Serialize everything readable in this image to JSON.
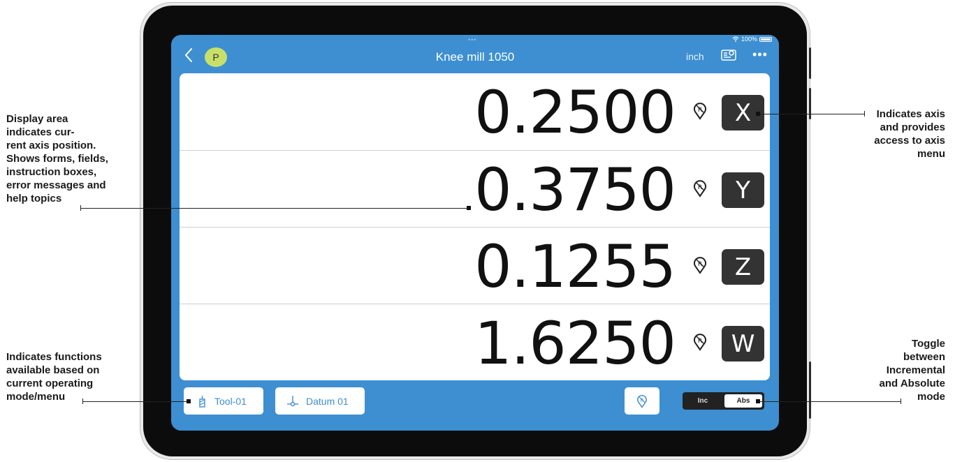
{
  "annotations": {
    "display_area": [
      "Display area",
      "indicates cur-",
      "rent axis position.",
      "Shows forms, fields,",
      "instruction boxes,",
      "error messages and",
      "help topics"
    ],
    "functions": [
      "Indicates functions",
      "available based on",
      "current operating",
      "mode/menu"
    ],
    "axis": [
      "Indicates axis",
      "and provides",
      "access to axis",
      "menu"
    ],
    "toggle": [
      "Toggle",
      "between",
      "Incremental",
      "and Absolute",
      "mode"
    ]
  },
  "status_bar": {
    "battery": "100%"
  },
  "header": {
    "profile_initial": "P",
    "title": "Knee mill 1050",
    "units": "inch"
  },
  "axes": [
    {
      "value": "0.2500",
      "label": "X"
    },
    {
      "value": "0.3750",
      "label": "Y"
    },
    {
      "value": "0.1255",
      "label": "Z"
    },
    {
      "value": "1.6250",
      "label": "W"
    }
  ],
  "footer": {
    "tool_label": "Tool-01",
    "datum_label": "Datum 01",
    "toggle_inc": "Inc",
    "toggle_abs": "Abs"
  },
  "colors": {
    "screen_blue": "#3d8fd1",
    "profile_green": "#c8e06a",
    "axis_key": "#333333"
  },
  "icons": [
    "back-chevron-icon",
    "display-settings-icon",
    "more-icon",
    "reference-mark-icon",
    "tool-icon",
    "datum-icon"
  ]
}
